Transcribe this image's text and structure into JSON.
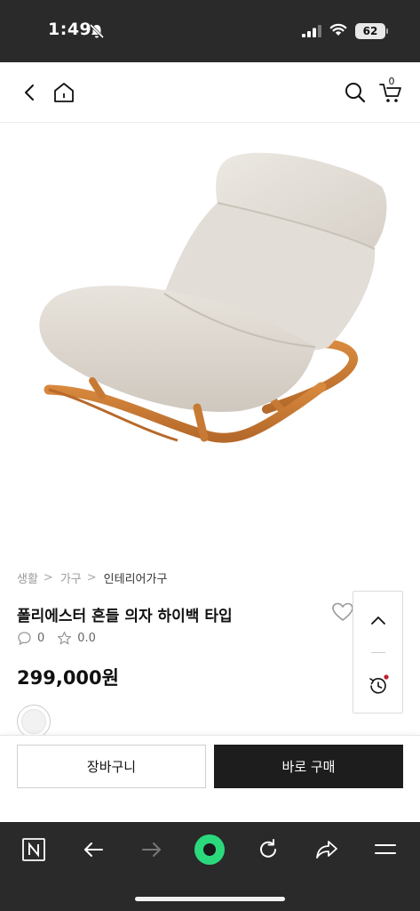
{
  "status_bar": {
    "time": "1:49",
    "battery": "62"
  },
  "header": {
    "cart_count": "0"
  },
  "product": {
    "breadcrumb": [
      "생활",
      "가구",
      "인테리어가구"
    ],
    "breadcrumb_separator": ">",
    "title": "폴리에스터 흔들 의자 하이백 타입",
    "review_count": "0",
    "rating": "0.0",
    "price": "299,000원"
  },
  "actions": {
    "add_to_cart": "장바구니",
    "buy_now": "바로 구매"
  },
  "colors": {
    "toolbar_bg": "#2a2a2a",
    "accent_green": "#2bd97c",
    "buy_button_bg": "#1d1d1d",
    "notification_dot": "#c0202c"
  }
}
